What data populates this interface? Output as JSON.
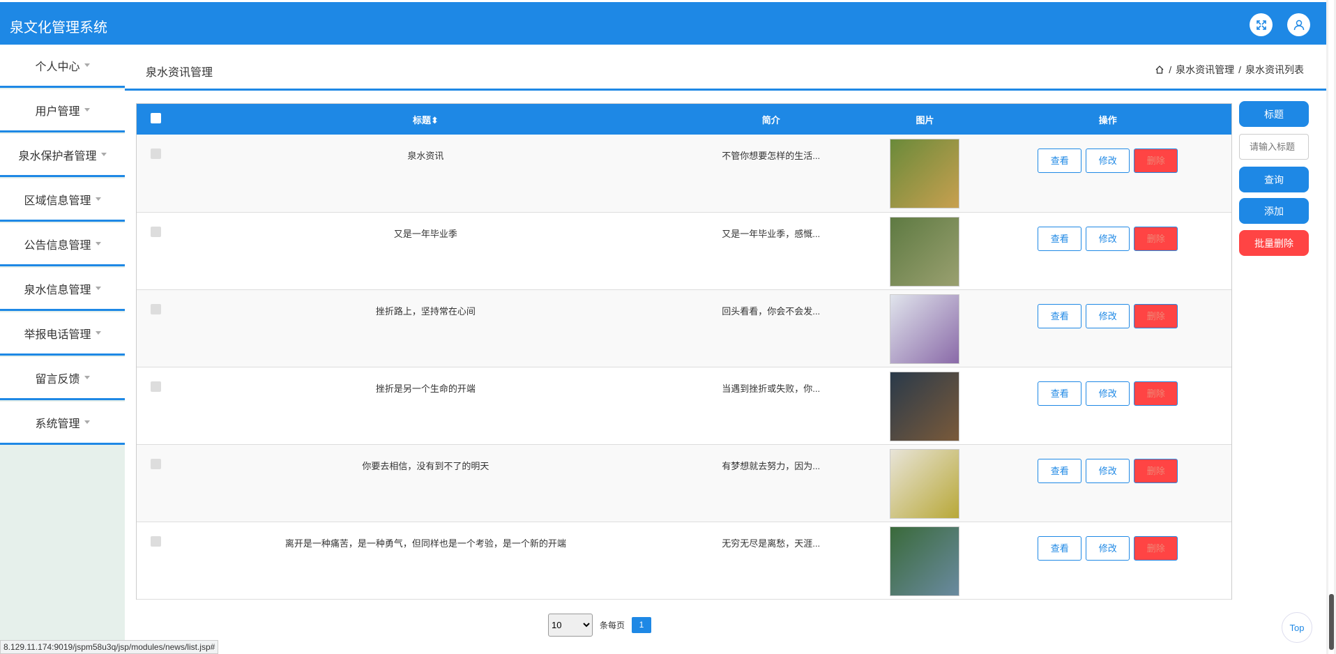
{
  "app": {
    "title": "泉文化管理系统"
  },
  "sidebar": {
    "items": [
      {
        "label": "个人中心"
      },
      {
        "label": "用户管理"
      },
      {
        "label": "泉水保护者管理"
      },
      {
        "label": "区域信息管理"
      },
      {
        "label": "公告信息管理"
      },
      {
        "label": "泉水信息管理"
      },
      {
        "label": "举报电话管理"
      },
      {
        "label": "留言反馈"
      },
      {
        "label": "系统管理"
      }
    ]
  },
  "header": {
    "page_title": "泉水资讯管理",
    "breadcrumb": [
      "泉水资讯管理",
      "泉水资讯列表"
    ]
  },
  "table": {
    "columns": {
      "title": "标题",
      "intro": "简介",
      "image": "图片",
      "actions": "操作"
    },
    "rows": [
      {
        "title": "泉水资讯",
        "intro": "不管你想要怎样的生活...",
        "image_colors": [
          "#6a8a3a",
          "#c8a050"
        ]
      },
      {
        "title": "又是一年毕业季",
        "intro": "又是一年毕业季，感慨...",
        "image_colors": [
          "#5e7a42",
          "#9aa070"
        ]
      },
      {
        "title": "挫折路上，坚持常在心间",
        "intro": "回头看看，你会不会发...",
        "image_colors": [
          "#e0e4ec",
          "#8a6aa8"
        ]
      },
      {
        "title": "挫折是另一个生命的开端",
        "intro": "当遇到挫折或失败，你...",
        "image_colors": [
          "#2a3a4a",
          "#7a5a3a"
        ]
      },
      {
        "title": "你要去相信，没有到不了的明天",
        "intro": "有梦想就去努力，因为...",
        "image_colors": [
          "#e8e4d8",
          "#b8a838"
        ]
      },
      {
        "title": "离开是一种痛苦，是一种勇气，但同样也是一个考验，是一个新的开端",
        "intro": "无穷无尽是离愁，天涯...",
        "image_colors": [
          "#3a6a3a",
          "#6a8aa0"
        ]
      }
    ],
    "actions": {
      "view": "查看",
      "edit": "修改",
      "delete": "删除"
    }
  },
  "right_panel": {
    "field_label": "标题",
    "search_placeholder": "请输入标题",
    "query": "查询",
    "add": "添加",
    "batch_delete": "批量删除"
  },
  "pagination": {
    "page_size": "10",
    "per_page_label": "条每页",
    "current_page": "1"
  },
  "status_url": "8.129.11.174:9019/jspm58u3q/jsp/modules/news/list.jsp#",
  "back_to_top": "Top",
  "colors": {
    "primary": "#1e88e5",
    "danger": "#ff4444"
  }
}
